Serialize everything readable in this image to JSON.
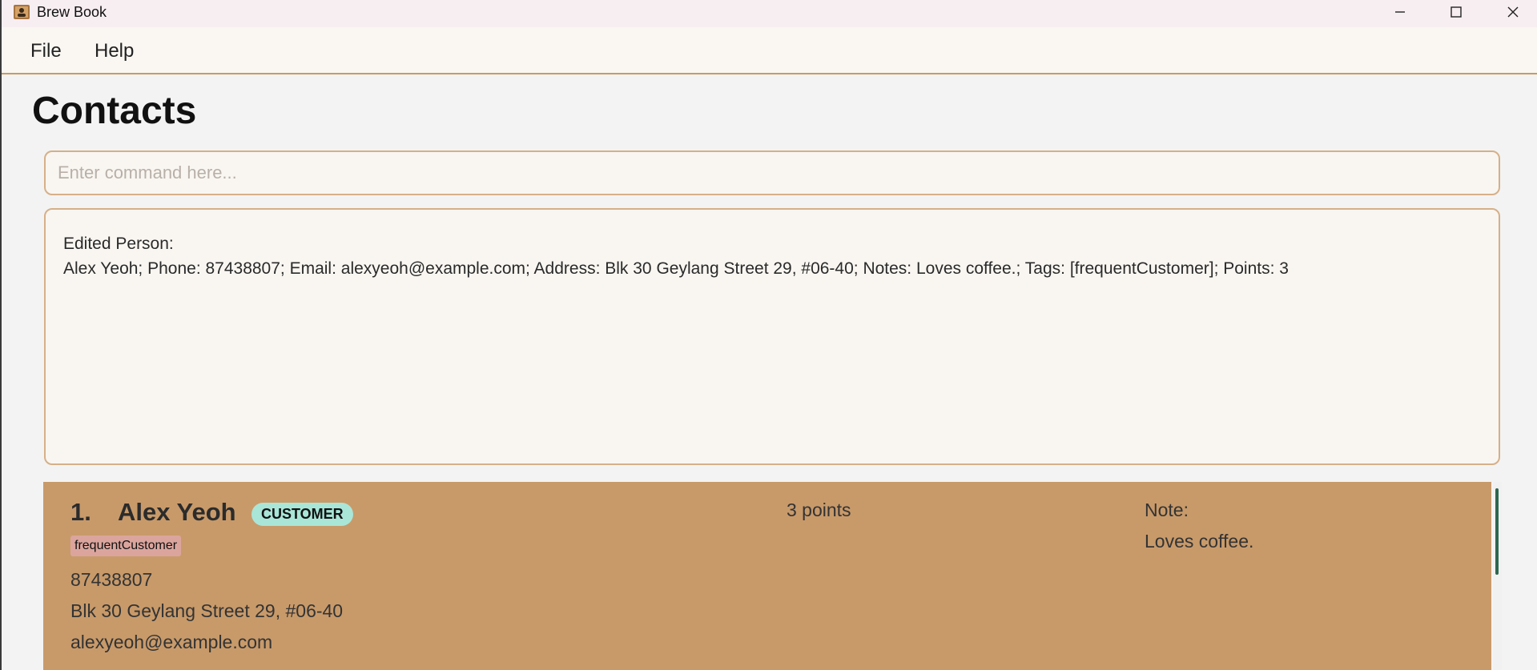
{
  "window": {
    "title": "Brew Book",
    "controls": [
      "minimize",
      "maximize",
      "close"
    ]
  },
  "menu": {
    "items": [
      "File",
      "Help"
    ]
  },
  "page": {
    "title": "Contacts"
  },
  "command": {
    "placeholder": "Enter command here...",
    "value": ""
  },
  "result": {
    "line1": "Edited Person:",
    "line2": "Alex Yeoh; Phone: 87438807; Email: alexyeoh@example.com; Address: Blk 30 Geylang Street 29, #06-40; Notes: Loves coffee.; Tags: [frequentCustomer]; Points: 3"
  },
  "contacts": [
    {
      "index": "1.",
      "name": "Alex Yeoh",
      "role": "CUSTOMER",
      "tag": "frequentCustomer",
      "phone": "87438807",
      "address": "Blk 30 Geylang Street 29, #06-40",
      "email": "alexyeoh@example.com",
      "points": "3 points",
      "note_label": "Note:",
      "note": "Loves coffee."
    }
  ],
  "colors": {
    "accent": "#c89a66",
    "card": "#c89a6a",
    "role_badge": "#a9e6d8",
    "tag": "#dba59d",
    "scroll_thumb": "#2e6650"
  }
}
